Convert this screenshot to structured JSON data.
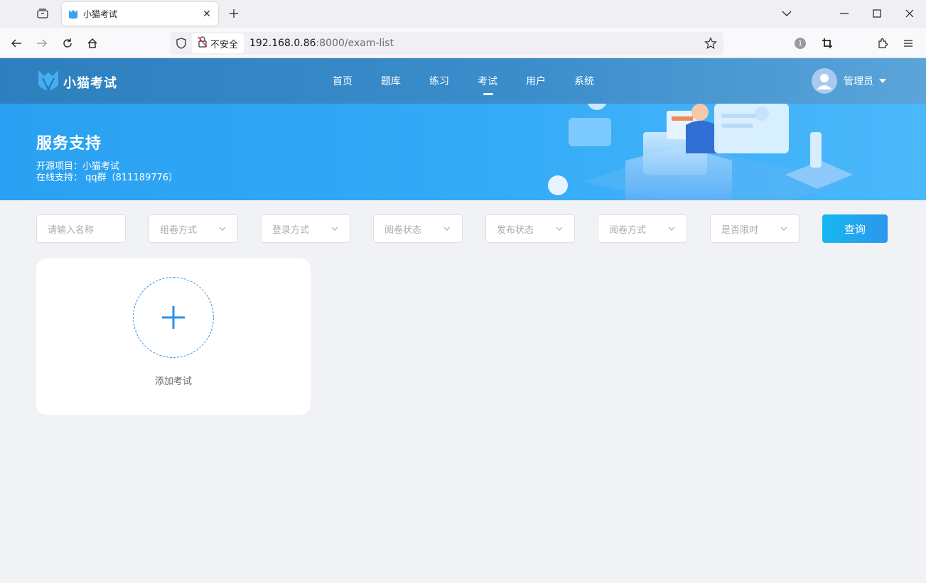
{
  "browser": {
    "tab_title": "小猫考试",
    "security_label": "不安全",
    "url_host": "192.168.0.86",
    "url_rest": ":8000/exam-list",
    "extension_badge": "1"
  },
  "header": {
    "logo_text": "小猫考试",
    "nav": [
      {
        "label": "首页",
        "active": false
      },
      {
        "label": "题库",
        "active": false
      },
      {
        "label": "练习",
        "active": false
      },
      {
        "label": "考试",
        "active": true
      },
      {
        "label": "用户",
        "active": false
      },
      {
        "label": "系统",
        "active": false
      }
    ],
    "user_name": "管理员"
  },
  "banner": {
    "title": "服务支持",
    "line1": "开源项目：小猫考试",
    "line2": "在线支持： qq群（811189776）"
  },
  "filters": {
    "name_placeholder": "请输入名称",
    "selects": [
      "组卷方式",
      "登录方式",
      "阅卷状态",
      "发布状态",
      "阅卷方式",
      "是否限时"
    ],
    "query_label": "查询"
  },
  "card": {
    "add_label": "添加考试"
  },
  "colors": {
    "header_bg": "#3a8ccb",
    "banner_bg": "#33aaf6",
    "accent": "#2b90e6",
    "page_bg": "#f1f2f5"
  }
}
